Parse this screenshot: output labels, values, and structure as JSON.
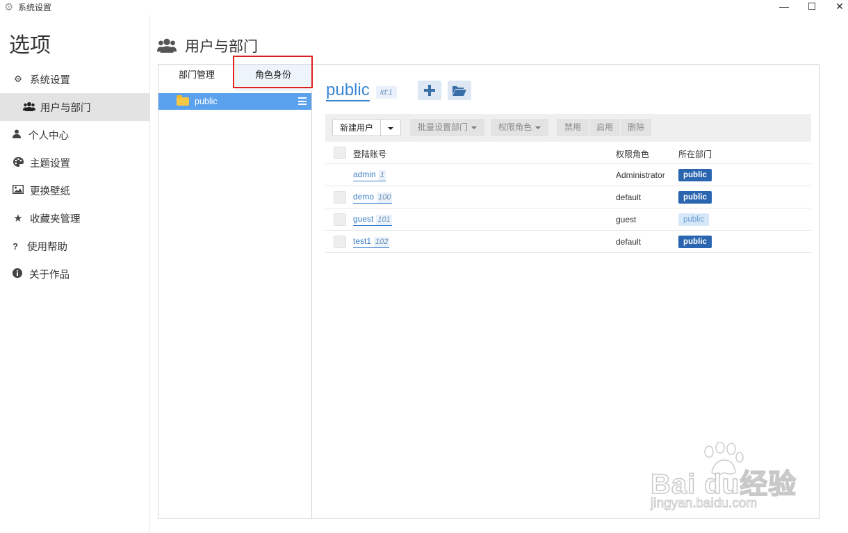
{
  "window": {
    "title": "系统设置",
    "controls": {
      "minimize": "—",
      "maximize": "☐",
      "close": "✕"
    }
  },
  "sidebar": {
    "heading": "选项",
    "items": [
      {
        "label": "系统设置",
        "icon": "gear-icon"
      },
      {
        "label": "用户与部门",
        "icon": "users-icon",
        "active": true
      },
      {
        "label": "个人中心",
        "icon": "user-icon"
      },
      {
        "label": "主题设置",
        "icon": "palette-icon"
      },
      {
        "label": "更换壁纸",
        "icon": "image-icon"
      },
      {
        "label": "收藏夹管理",
        "icon": "star-icon"
      },
      {
        "label": "使用帮助",
        "icon": "question-icon"
      },
      {
        "label": "关于作品",
        "icon": "info-icon"
      }
    ]
  },
  "page": {
    "title": "用户与部门",
    "icon": "users-icon"
  },
  "tabs": [
    {
      "label": "部门管理"
    },
    {
      "label": "角色身份",
      "active": true
    }
  ],
  "tree": {
    "nodes": [
      {
        "label": "public",
        "selected": true
      }
    ]
  },
  "dept": {
    "name": "public",
    "id_label": "id:1"
  },
  "toolbar": {
    "new_user": "新建用户",
    "batch_dept": "批量设置部门",
    "role": "权限角色",
    "disable": "禁用",
    "enable": "启用",
    "delete": "删除"
  },
  "table": {
    "columns": {
      "account": "登陆账号",
      "role": "权限角色",
      "dept": "所在部门"
    },
    "rows": [
      {
        "account": "admin",
        "id": "1",
        "role": "Administrator",
        "dept": "public",
        "has_checkbox": false,
        "dept_style": "dark"
      },
      {
        "account": "demo",
        "id": "100",
        "role": "default",
        "dept": "public",
        "has_checkbox": true,
        "dept_style": "dark"
      },
      {
        "account": "guest",
        "id": "101",
        "role": "guest",
        "dept": "public",
        "has_checkbox": true,
        "dept_style": "light"
      },
      {
        "account": "test1",
        "id": "102",
        "role": "default",
        "dept": "public",
        "has_checkbox": true,
        "dept_style": "dark"
      }
    ]
  },
  "colors": {
    "accent": "#3a86d4",
    "selected_row": "#5aa2ee",
    "badge_dark": "#2a65b0",
    "badge_light": "#d6e7f8",
    "highlight_box": "#e02020"
  },
  "watermark": {
    "brand": "Bai du经验",
    "url": "jingyan.baidu.com"
  }
}
